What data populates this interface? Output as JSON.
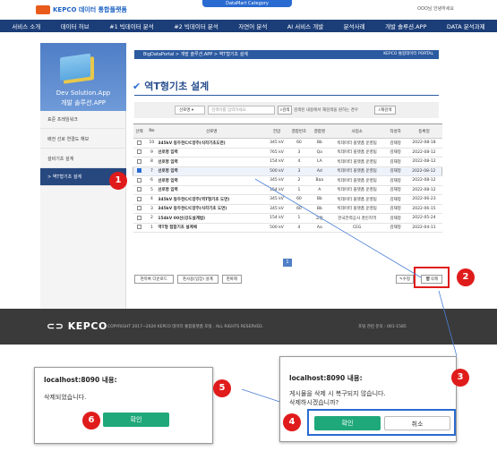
{
  "header": {
    "logo_text": "KEPCO 데이터 통합플랫폼",
    "datamart_tab": "DataMart Category",
    "welcome": "OOO님 안녕하세요"
  },
  "nav": [
    "서비스 소개",
    "데이터 허브",
    "#1 빅데이터 분석",
    "#2 빅데이터 분석",
    "자연어 분석",
    "AI 서비스 개발",
    "분석사례",
    "개발 솔루션.APP",
    "DATA 분석과제"
  ],
  "sidebar": {
    "title_en": "Dev Solution.App",
    "title_ko": "개발 솔루션.APP",
    "items": [
      "표준 프레임워크",
      "배전 선로 연결도 해보",
      "설비기초 설계",
      "> 역T형기초 설계"
    ]
  },
  "breadcrumb": "BigDataPortal > 개발 솔루션.APP > 역T형기초 설계",
  "breadcrumb_right": "KEPCO 통합데이터 PORTAL",
  "page_title": "역T형기초 설계",
  "search": {
    "select": "선로명",
    "placeholder": "검색어를 입력하세요",
    "search_btn": "검색",
    "hint": "검색된 내용에서 재검색을 원하는 경우",
    "research_btn": "재검색"
  },
  "table": {
    "headers": [
      "선택",
      "No",
      "선로명",
      "전압",
      "결합번호",
      "결합명",
      "사업소",
      "작성자",
      "등록일"
    ],
    "rows": [
      {
        "no": "10",
        "name": "345kV 동두천C/C양주(식각기초도면)",
        "volt": "345 kV",
        "num": "60",
        "code": "Bb",
        "office": "빅데이터 플랫폼 운영팀",
        "author": "김재정",
        "date": "2022-08-18",
        "checked": false
      },
      {
        "no": "9",
        "name": "선로명 입력",
        "volt": "765 kV",
        "num": "3",
        "code": "Qa",
        "office": "빅데이터 플랫폼 운영팀",
        "author": "김재정",
        "date": "2022-08-12",
        "checked": false
      },
      {
        "no": "8",
        "name": "선로명 입력",
        "volt": "154 kV",
        "num": "4",
        "code": "LA",
        "office": "빅데이터 플랫폼 운영팀",
        "author": "김재정",
        "date": "2022-08-12",
        "checked": false
      },
      {
        "no": "7",
        "name": "선로명 입력",
        "volt": "500 kV",
        "num": "3",
        "code": "Ad",
        "office": "빅데이터 플랫폼 운영팀",
        "author": "김재정",
        "date": "2022-08-12",
        "checked": true
      },
      {
        "no": "6",
        "name": "선로명 입력",
        "volt": "345 kV",
        "num": "2",
        "code": "Baa",
        "office": "빅데이터 플랫폼 운영팀",
        "author": "김재정",
        "date": "2022-08-12",
        "checked": false
      },
      {
        "no": "5",
        "name": "선로명 입력",
        "volt": "154 kV",
        "num": "1",
        "code": "A",
        "office": "빅데이터 플랫폼 운영팀",
        "author": "김재정",
        "date": "2022-08-12",
        "checked": false
      },
      {
        "no": "4",
        "name": "345kV 동두천C/C양주(역T형기초 도면)",
        "volt": "345 kV",
        "num": "60",
        "code": "Bb",
        "office": "빅데이터 플랫폼 운영팀",
        "author": "김재정",
        "date": "2022-06-23",
        "checked": false
      },
      {
        "no": "3",
        "name": "345kV 동두천C/C양주(식각기초 도면)",
        "volt": "345 kV",
        "num": "60",
        "code": "Bb",
        "office": "빅데이터 플랫폼 운영팀",
        "author": "김재정",
        "date": "2022-06-15",
        "checked": false
      },
      {
        "no": "2",
        "name": "154kV 00선(강도설계법)",
        "volt": "154 kV",
        "num": "1",
        "code": "고등",
        "office": "한국전력공사 경인지역",
        "author": "김재정",
        "date": "2022-05-24",
        "checked": false
      },
      {
        "no": "1",
        "name": "역T형 접합기초 설계예",
        "volt": "500 kV",
        "num": "4",
        "code": "Aa",
        "office": "CEG",
        "author": "김재정",
        "date": "2022-04-11",
        "checked": false
      }
    ]
  },
  "pager": "1",
  "buttons": {
    "list_download": "목록 다운로드",
    "use_manual": "사용(입장) 설계",
    "copy": "복제",
    "edit": "수정",
    "delete": "삭제"
  },
  "footer": {
    "logo": "KEPCO",
    "copyright": "COPYRIGHT 2017~2020 KEPCO 데이터 통합플랫폼 포털 . ALL RIGHTS RESERVED.",
    "contact": "포털 관련 문의 : 061-1585"
  },
  "dialog_confirm": {
    "title": "localhost:8090 내용:",
    "message1": "게시물을 삭제 시 복구되지 않습니다.",
    "message2": "삭제하시겠습니까?",
    "ok": "확인",
    "cancel": "취소"
  },
  "dialog_done": {
    "title": "localhost:8090 내용:",
    "message": "삭제되었습니다.",
    "ok": "확인"
  },
  "steps": [
    "1",
    "2",
    "3",
    "4",
    "5",
    "6"
  ],
  "colors": {
    "accent": "#e01b1b",
    "nav": "#1b3d78",
    "ok": "#1fa97a",
    "highlight": "#2a6bd1"
  }
}
